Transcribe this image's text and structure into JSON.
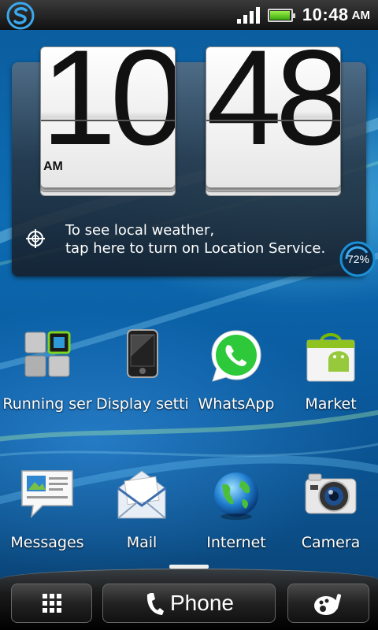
{
  "status_bar": {
    "time": "10:48",
    "ampm": "AM",
    "battery_level": 0.95,
    "signal_bars": 4
  },
  "clock_widget": {
    "hour": "10",
    "minute": "48",
    "ampm": "AM",
    "weather_line1": "To see local weather,",
    "weather_line2": "tap here to turn on Location Service.",
    "sync_percent": "72%"
  },
  "apps": [
    {
      "label": "Running ser",
      "icon": "running-services-icon"
    },
    {
      "label": "Display setti",
      "icon": "display-settings-icon"
    },
    {
      "label": "WhatsApp",
      "icon": "whatsapp-icon"
    },
    {
      "label": "Market",
      "icon": "market-icon"
    },
    {
      "label": "Messages",
      "icon": "messages-icon"
    },
    {
      "label": "Mail",
      "icon": "mail-icon"
    },
    {
      "label": "Internet",
      "icon": "internet-globe-icon"
    },
    {
      "label": "Camera",
      "icon": "camera-icon"
    }
  ],
  "dock": {
    "phone_label": "Phone"
  },
  "colors": {
    "accent": "#1a8fd6",
    "whatsapp_green": "#2ec93b",
    "wallpaper": "#0d6cb3"
  }
}
